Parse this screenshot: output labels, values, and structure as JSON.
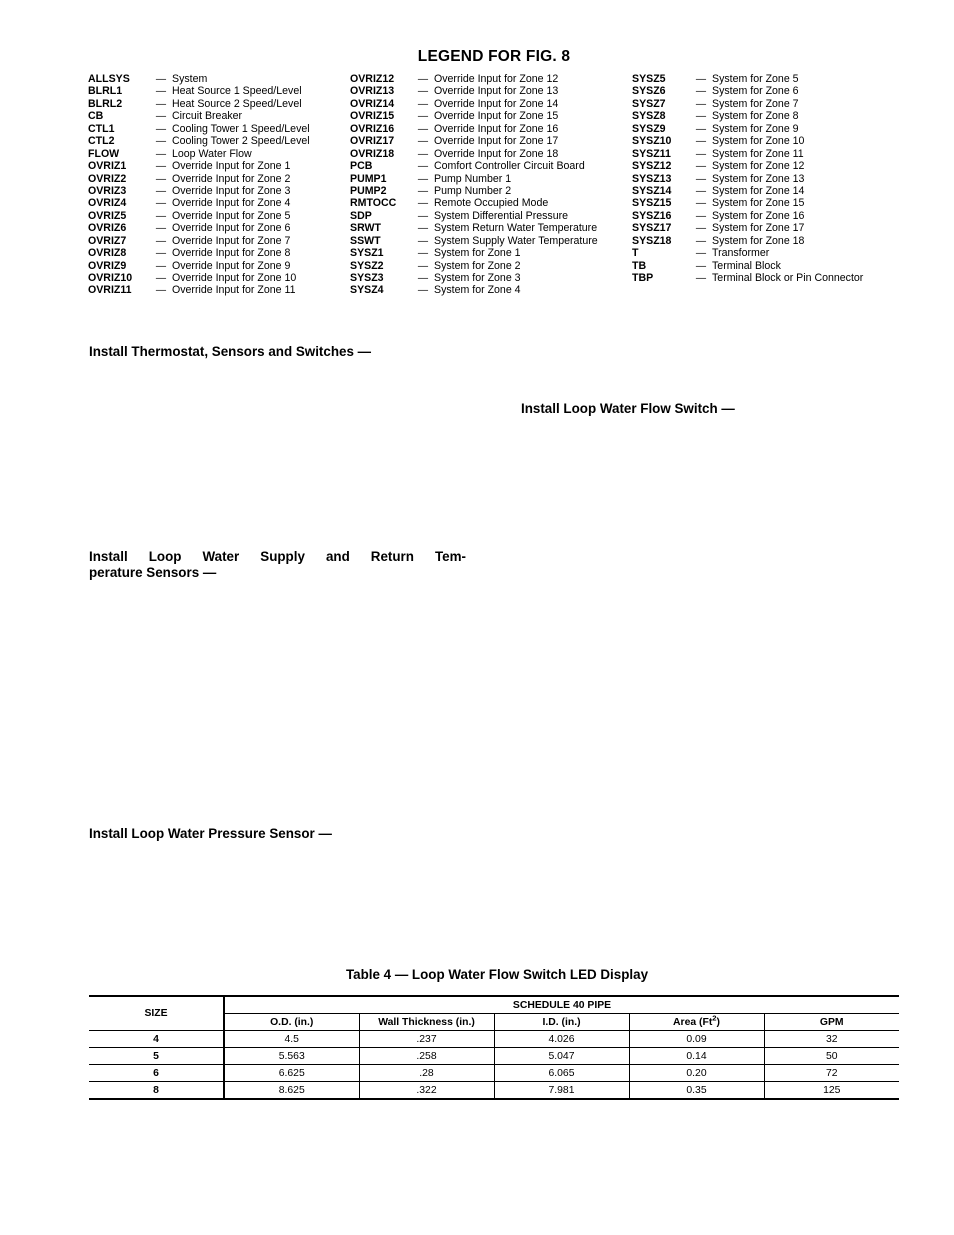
{
  "legend": {
    "title": "LEGEND FOR FIG. 8",
    "dash": "—",
    "columns": [
      {
        "name": "legend-column-1",
        "entries": [
          {
            "term": "ALLSYS",
            "desc": "System"
          },
          {
            "term": "BLRL1",
            "desc": "Heat Source 1 Speed/Level"
          },
          {
            "term": "BLRL2",
            "desc": "Heat Source 2 Speed/Level"
          },
          {
            "term": "CB",
            "desc": "Circuit Breaker"
          },
          {
            "term": "CTL1",
            "desc": "Cooling Tower 1 Speed/Level"
          },
          {
            "term": "CTL2",
            "desc": "Cooling Tower 2 Speed/Level"
          },
          {
            "term": "FLOW",
            "desc": "Loop Water Flow"
          },
          {
            "term": "OVRIZ1",
            "desc": "Override Input for Zone 1"
          },
          {
            "term": "OVRIZ2",
            "desc": "Override Input for Zone 2"
          },
          {
            "term": "OVRIZ3",
            "desc": "Override Input for Zone 3"
          },
          {
            "term": "OVRIZ4",
            "desc": "Override Input for Zone 4"
          },
          {
            "term": "OVRIZ5",
            "desc": "Override Input for Zone 5"
          },
          {
            "term": "OVRIZ6",
            "desc": "Override Input for Zone 6"
          },
          {
            "term": "OVRIZ7",
            "desc": "Override Input for Zone 7"
          },
          {
            "term": "OVRIZ8",
            "desc": "Override Input for Zone 8"
          },
          {
            "term": "OVRIZ9",
            "desc": "Override Input for Zone 9"
          },
          {
            "term": "OVRIZ10",
            "desc": "Override Input for Zone 10"
          },
          {
            "term": "OVRIZ11",
            "desc": "Override Input for Zone 11"
          }
        ]
      },
      {
        "name": "legend-column-2",
        "entries": [
          {
            "term": "OVRIZ12",
            "desc": "Override Input for Zone 12"
          },
          {
            "term": "OVRIZ13",
            "desc": "Override Input for Zone 13"
          },
          {
            "term": "OVRIZ14",
            "desc": "Override Input for Zone 14"
          },
          {
            "term": "OVRIZ15",
            "desc": "Override Input for Zone 15"
          },
          {
            "term": "OVRIZ16",
            "desc": "Override Input for Zone 16"
          },
          {
            "term": "OVRIZ17",
            "desc": "Override Input for Zone 17"
          },
          {
            "term": "OVRIZ18",
            "desc": "Override Input for Zone 18"
          },
          {
            "term": "PCB",
            "desc": "Comfort Controller Circuit Board"
          },
          {
            "term": "PUMP1",
            "desc": "Pump Number 1"
          },
          {
            "term": "PUMP2",
            "desc": "Pump Number 2"
          },
          {
            "term": "RMTOCC",
            "desc": "Remote Occupied Mode"
          },
          {
            "term": "SDP",
            "desc": "System Differential Pressure"
          },
          {
            "term": "SRWT",
            "desc": "System Return Water Temperature"
          },
          {
            "term": "SSWT",
            "desc": "System Supply Water Temperature"
          },
          {
            "term": "SYSZ1",
            "desc": "System for Zone 1"
          },
          {
            "term": "SYSZ2",
            "desc": "System for Zone 2"
          },
          {
            "term": "SYSZ3",
            "desc": "System for Zone 3"
          },
          {
            "term": "SYSZ4",
            "desc": "System for Zone 4"
          }
        ]
      },
      {
        "name": "legend-column-3",
        "entries": [
          {
            "term": "SYSZ5",
            "desc": "System for Zone 5"
          },
          {
            "term": "SYSZ6",
            "desc": "System for Zone 6"
          },
          {
            "term": "SYSZ7",
            "desc": "System for Zone 7"
          },
          {
            "term": "SYSZ8",
            "desc": "System for Zone 8"
          },
          {
            "term": "SYSZ9",
            "desc": "System for Zone 9"
          },
          {
            "term": "SYSZ10",
            "desc": "System for Zone 10"
          },
          {
            "term": "SYSZ11",
            "desc": "System for Zone 11"
          },
          {
            "term": "SYSZ12",
            "desc": "System for Zone 12"
          },
          {
            "term": "SYSZ13",
            "desc": "System for Zone 13"
          },
          {
            "term": "SYSZ14",
            "desc": "System for Zone 14"
          },
          {
            "term": "SYSZ15",
            "desc": "System for Zone 15"
          },
          {
            "term": "SYSZ16",
            "desc": "System for Zone 16"
          },
          {
            "term": "SYSZ17",
            "desc": "System for Zone 17"
          },
          {
            "term": "SYSZ18",
            "desc": "System for Zone 18"
          },
          {
            "term": "T",
            "desc": "Transformer"
          },
          {
            "term": "TB",
            "desc": "Terminal Block"
          },
          {
            "term": "TBP",
            "desc": "Terminal Block or Pin Connector"
          }
        ]
      }
    ]
  },
  "headings": {
    "thermostat": "Install Thermostat, Sensors and Switches —",
    "flow_switch": "Install Loop Water Flow Switch —",
    "temperature_line1": "Install Loop Water Supply and Return Tem-",
    "temperature_line2": "perature Sensors —",
    "pressure": "Install Loop Water Pressure Sensor —"
  },
  "table": {
    "caption": "Table 4 — Loop Water Flow Switch LED Display",
    "size_header": "SIZE",
    "group_header": "SCHEDULE 40 PIPE",
    "sub_headers": [
      "O.D. (in.)",
      "Wall Thickness (in.)",
      "I.D. (in.)",
      "Area (Ft",
      "GPM"
    ],
    "area_header_base": "Area (Ft",
    "area_header_sup": "2",
    "area_header_tail": ")",
    "rows": [
      {
        "size": "4",
        "od": "4.5",
        "wall": ".237",
        "id": "4.026",
        "area": "0.09",
        "gpm": "32"
      },
      {
        "size": "5",
        "od": "5.563",
        "wall": ".258",
        "id": "5.047",
        "area": "0.14",
        "gpm": "50"
      },
      {
        "size": "6",
        "od": "6.625",
        "wall": ".28",
        "id": "6.065",
        "area": "0.20",
        "gpm": "72"
      },
      {
        "size": "8",
        "od": "8.625",
        "wall": ".322",
        "id": "7.981",
        "area": "0.35",
        "gpm": "125"
      }
    ]
  },
  "colors": {
    "text": "#000000",
    "background": "#ffffff",
    "rule": "#000000"
  }
}
